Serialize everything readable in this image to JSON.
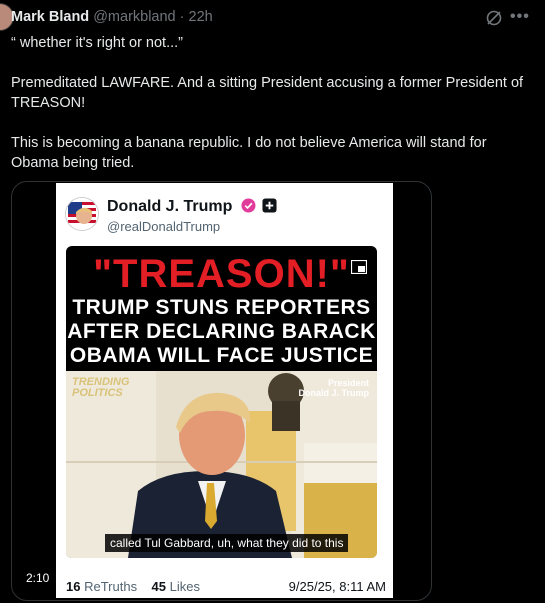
{
  "post": {
    "author_name": "Mark Bland",
    "author_handle": "@markbland",
    "separator": "·",
    "time": "22h",
    "lines": [
      "“ whether it's right or not...”",
      "Premeditated LAWFARE. And a sitting President accusing a former President of TREASON!",
      "This is becoming a banana republic. I do not believe America will stand for Obama being tried."
    ]
  },
  "icons": {
    "grok": "grok-icon",
    "more": "more-icon",
    "verified": "verified-icon",
    "plus": "plus-icon",
    "pip": "picture-in-picture-icon"
  },
  "embed": {
    "name": "Donald J. Trump",
    "handle": "@realDonaldTrump",
    "video": {
      "headline_red": "\"TREASON!\"",
      "headline_white": [
        "TRUMP STUNS REPORTERS",
        "AFTER DECLARING BARACK",
        "OBAMA WILL FACE JUSTICE"
      ],
      "brand": [
        "TRENDING",
        "POLITICS"
      ],
      "lower_tag": [
        "President",
        "Donald J. Trump"
      ],
      "caption": "called Tul Gabbard, uh, what they did to this"
    },
    "retruths_count": "16",
    "retruths_label": "ReTruths",
    "likes_count": "45",
    "likes_label": "Likes",
    "date": "9/25/25, 8:11 AM"
  },
  "media": {
    "duration": "2:10"
  },
  "colors": {
    "background": "#000000",
    "accent_red": "#e31e24",
    "verified": "#e23c9b",
    "muted": "#71767b"
  }
}
